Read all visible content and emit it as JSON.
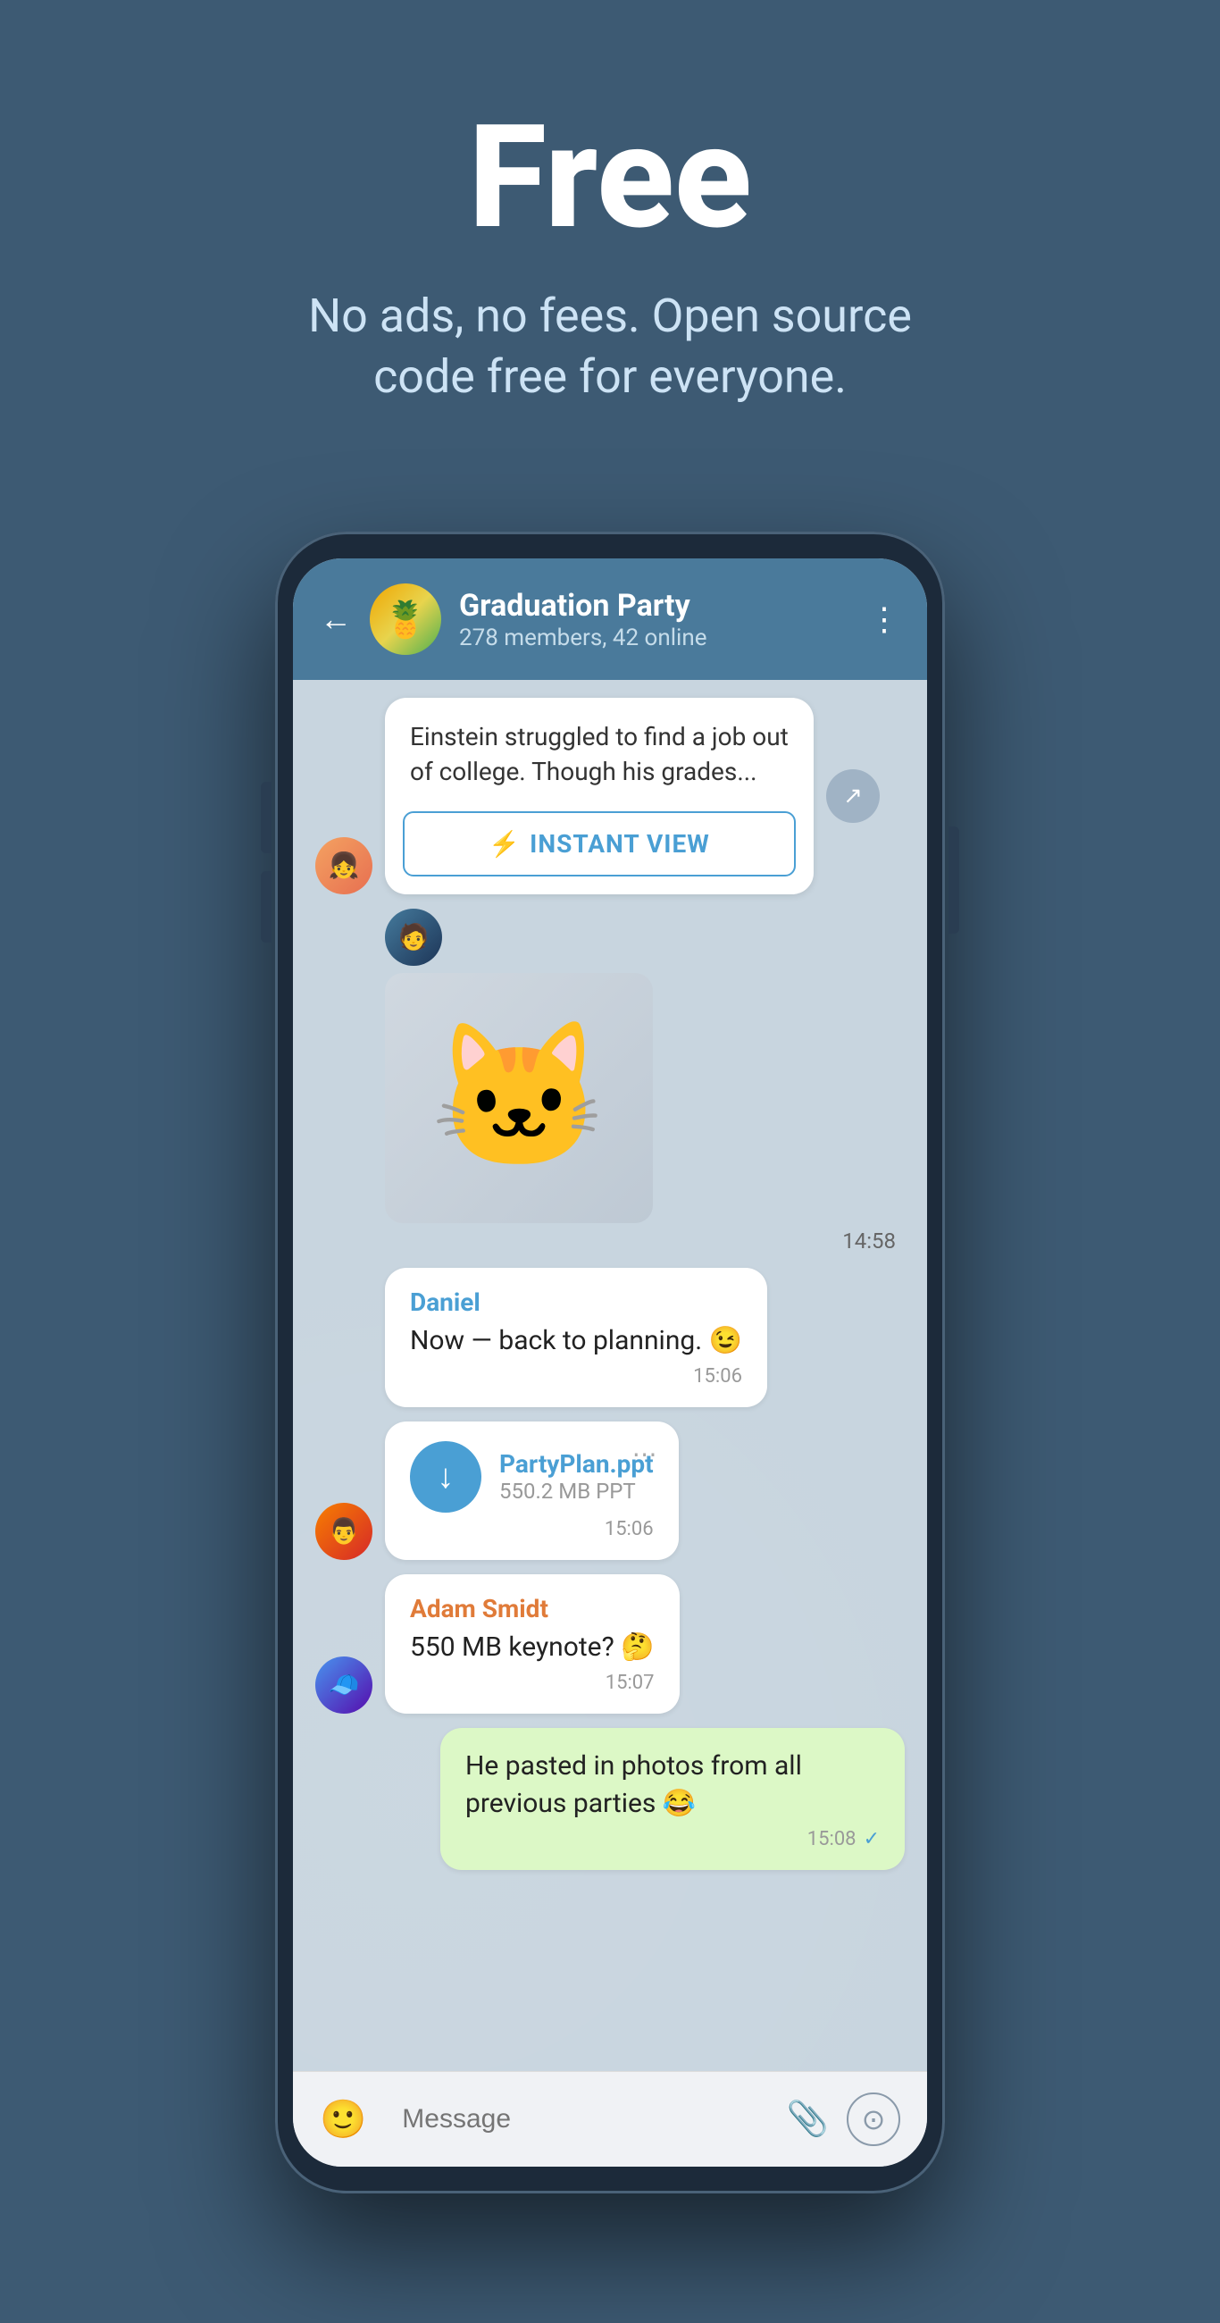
{
  "hero": {
    "title": "Free",
    "subtitle": "No ads, no fees. Open source code free for everyone."
  },
  "phone": {
    "header": {
      "group_name": "Graduation Party",
      "members_info": "278 members, 42 online"
    },
    "messages": [
      {
        "id": "article-msg",
        "type": "article",
        "text": "Einstein struggled to find a job out of college. Though his grades...",
        "instant_view_label": "INSTANT VIEW",
        "sender": "girl"
      },
      {
        "id": "sticker-msg",
        "type": "sticker",
        "time": "14:58",
        "sender": "guy1"
      },
      {
        "id": "daniel-msg",
        "type": "text",
        "sender_name": "Daniel",
        "text": "Now — back to planning. 😉",
        "time": "15:06"
      },
      {
        "id": "file-msg",
        "type": "file",
        "file_name": "PartyPlan.ppt",
        "file_size": "550.2 MB PPT",
        "time": "15:06",
        "sender": "guy2"
      },
      {
        "id": "adam-msg",
        "type": "text",
        "sender_name": "Adam Smidt",
        "text": "550 MB keynote? 🤔",
        "time": "15:07",
        "sender": "guy3"
      },
      {
        "id": "outgoing-msg",
        "type": "text_outgoing",
        "text": "He pasted in photos from all previous parties 😂",
        "time": "15:08",
        "check": "✓"
      }
    ],
    "input": {
      "placeholder": "Message"
    }
  }
}
